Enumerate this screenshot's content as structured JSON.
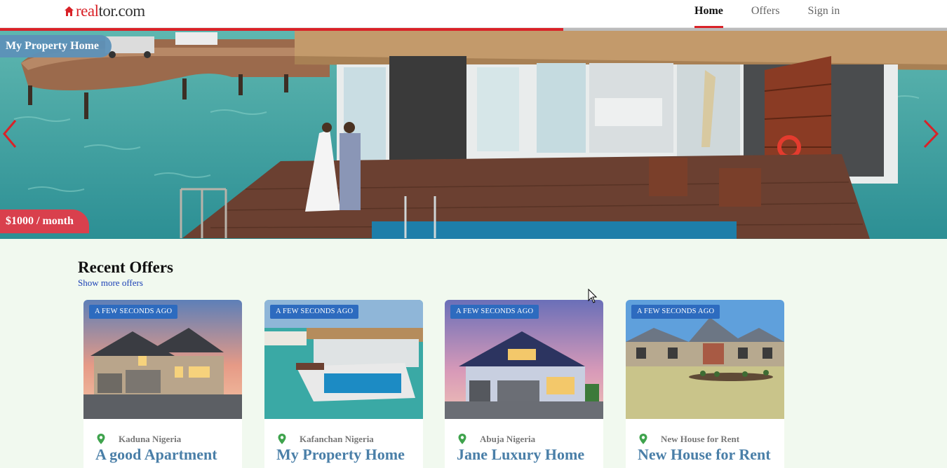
{
  "brand": {
    "logo_red": "real",
    "logo_dark": "tor.com",
    "accent": "#d92228"
  },
  "nav": {
    "items": [
      {
        "label": "Home",
        "active": true
      },
      {
        "label": "Offers",
        "active": false
      },
      {
        "label": "Sign in",
        "active": false
      }
    ]
  },
  "hero": {
    "tag": "My Property Home",
    "price": "$1000 / month",
    "progress_percent": 59.5,
    "prev_icon": "chevron-left-icon",
    "next_icon": "chevron-right-icon"
  },
  "offers": {
    "title": "Recent Offers",
    "show_more": "Show more offers",
    "cards": [
      {
        "badge": "A FEW SECONDS AGO",
        "location": "Kaduna Nigeria",
        "title": "A good Apartment"
      },
      {
        "badge": "A FEW SECONDS AGO",
        "location": "Kafanchan Nigeria",
        "title": "My Property Home"
      },
      {
        "badge": "A FEW SECONDS AGO",
        "location": "Abuja Nigeria",
        "title": "Jane Luxury Home"
      },
      {
        "badge": "A FEW SECONDS AGO",
        "location": "New House for Rent",
        "title": "New House for Rent"
      }
    ]
  }
}
